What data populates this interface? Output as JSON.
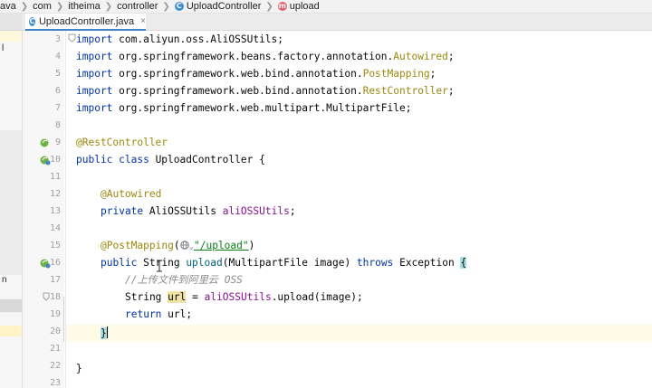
{
  "breadcrumb": {
    "items": [
      "ava",
      "com",
      "itheima",
      "controller",
      "UploadController",
      "upload"
    ],
    "class_icon": "C",
    "method_icon": "m"
  },
  "tab": {
    "label": "UploadController.java",
    "icon": "C",
    "close": "×"
  },
  "left_panel": {
    "fragments": [
      "l",
      "n"
    ]
  },
  "editor": {
    "lines": [
      {
        "no": "3"
      },
      {
        "no": "4"
      },
      {
        "no": "5"
      },
      {
        "no": "6"
      },
      {
        "no": "7"
      },
      {
        "no": "8"
      },
      {
        "no": "9"
      },
      {
        "no": "10"
      },
      {
        "no": "11"
      },
      {
        "no": "12"
      },
      {
        "no": "13"
      },
      {
        "no": "14"
      },
      {
        "no": "15"
      },
      {
        "no": "16"
      },
      {
        "no": "17"
      },
      {
        "no": "18"
      },
      {
        "no": "19"
      },
      {
        "no": "20"
      },
      {
        "no": "21"
      },
      {
        "no": "22"
      },
      {
        "no": "23"
      }
    ],
    "code": {
      "l3_kw": "import",
      "l3_rest": " com.aliyun.oss.AliOSSUtils;",
      "l4_kw": "import",
      "l4_a": " org.springframework.beans.factory.annotation.",
      "l4_b": "Autowired",
      "l4_c": ";",
      "l5_kw": "import",
      "l5_a": " org.springframework.web.bind.annotation.",
      "l5_b": "PostMapping",
      "l5_c": ";",
      "l6_kw": "import",
      "l6_a": " org.springframework.web.bind.annotation.",
      "l6_b": "RestController",
      "l6_c": ";",
      "l7_kw": "import",
      "l7_rest": " org.springframework.web.multipart.MultipartFile;",
      "l9_ann": "@RestController",
      "l10_kw": "public class",
      "l10_rest": " UploadController {",
      "l12_ann": "@Autowired",
      "l13_kw": "private",
      "l13_a": " AliOSSUtils ",
      "l13_field": "aliOSSUtils",
      "l13_c": ";",
      "l15_ann": "@PostMapping",
      "l15_a": "(",
      "l15_globe": "🌐",
      "l15_chev": "⌄",
      "l15_str": "\"/upload\"",
      "l15_c": ")",
      "l16_kw": "public",
      "l16_a": " String ",
      "l16_m": "upload",
      "l16_b": "(MultipartFile image) ",
      "l16_kw2": "throws",
      "l16_c": " Exception ",
      "l16_brace": "{",
      "l17_comment": "//上传文件到阿里云 OSS",
      "l18_a": "String ",
      "l18_var": "url",
      "l18_b": " = ",
      "l18_field": "aliOSSUtils",
      "l18_c": ".upload(image);",
      "l19_kw": "return",
      "l19_rest": " url;",
      "l20_brace": "}",
      "l22": "}"
    }
  },
  "colors": {
    "keyword": "#0033b3",
    "annotation": "#9e880d",
    "string": "#067d17",
    "field": "#871094",
    "comment": "#8c8c8c",
    "accent": "#4083c9"
  }
}
